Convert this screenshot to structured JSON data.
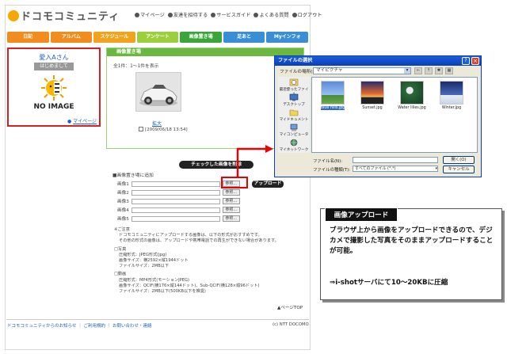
{
  "brand": {
    "logo_text": "ドコモコミュニティ"
  },
  "top_links": [
    "マイページ",
    "友達を招待する",
    "サービスガイド",
    "よくある質問",
    "ログアウト"
  ],
  "nav": {
    "tabs": [
      {
        "label": "日記",
        "color": "#f28c1e"
      },
      {
        "label": "アルバム",
        "color": "#f28c1e"
      },
      {
        "label": "スケジュール",
        "color": "#f2a31e"
      },
      {
        "label": "アンケート",
        "color": "#9ccf3c"
      },
      {
        "label": "画像置き場",
        "color": "#3aa63a"
      },
      {
        "label": "足あと",
        "color": "#3a8ed6"
      },
      {
        "label": "Myインフォ",
        "color": "#3a8ed6"
      }
    ]
  },
  "profile": {
    "name": "愛入Aさん",
    "badge": "はじめまして",
    "no_image": "NO IMAGE",
    "mypage_link": "マイページ"
  },
  "panel": {
    "title": "画像置き場",
    "count": "全1件：1〜1件を表示",
    "enlarge_link": "拡大",
    "date_stamp": "[2009/06/18 13:54]"
  },
  "delete_button": "チェックした画像を削除",
  "upload_section": {
    "title": "■画像置き場に追加",
    "rows": [
      "画像1",
      "画像2",
      "画像3",
      "画像4",
      "画像5"
    ],
    "browse_label": "参照...",
    "upload_button": "アップロード"
  },
  "notes": [
    "※ご注意",
    "ドコモコミュニティにアップロードする画像は、以下の形式がおすすめです。",
    "その他の形式の画像は、アップロードや携帯電話での再生ができない場合があります。",
    "□写真",
    "圧縮形式：JPEG形式(jpg)",
    "画像サイズ：横2592×縦1944ドット",
    "ファイルサイズ：2MB以下",
    "□動画",
    "圧縮形式：MP4形式(モーションJPEG)",
    "画像サイズ：QCIF(横176×縦144ドット)、Sub-QCIF(横128×縦96ドット)",
    "ファイルサイズ：2MB以下(500KB以下を推奨)"
  ],
  "page_top": "▲ページTOP",
  "footer": {
    "links": "ドコモコミュニティからのお知らせ ｜ ご利用規約 ｜ お問い合わせ・連絡",
    "copyright": "(c) NTT DOCOMO"
  },
  "dialog": {
    "title": "ファイルの選択",
    "look_in_label": "ファイルの場所(I):",
    "look_in_value": "マイピクチャ",
    "places": [
      "最近使ったファイル",
      "デスクトップ",
      "マイドキュメント",
      "マイコンピュータ",
      "マイネットワーク"
    ],
    "files": [
      {
        "name": "Blue hills.jpg",
        "selected": true,
        "color": "#2c5ca8"
      },
      {
        "name": "Sunset.jpg",
        "selected": false,
        "color": "#c86030"
      },
      {
        "name": "Water lilies.jpg",
        "selected": false,
        "color": "#2a6a3a"
      },
      {
        "name": "Winter.jpg",
        "selected": false,
        "color": "#3a4c8c"
      }
    ],
    "filename_label": "ファイル名(N):",
    "filetype_label": "ファイルの種類(T):",
    "filetype_value": "すべてのファイル (*.*)",
    "open_button": "開く(O)",
    "cancel_button": "キャンセル"
  },
  "callout": {
    "heading": "画像アップロード",
    "body": "ブラウザ上から画像をアップロードできるので、デジカメで撮影した写真をそのままアップロードすることが可能。",
    "note": "⇒i-shotサーバにて10〜20KBに圧縮"
  }
}
